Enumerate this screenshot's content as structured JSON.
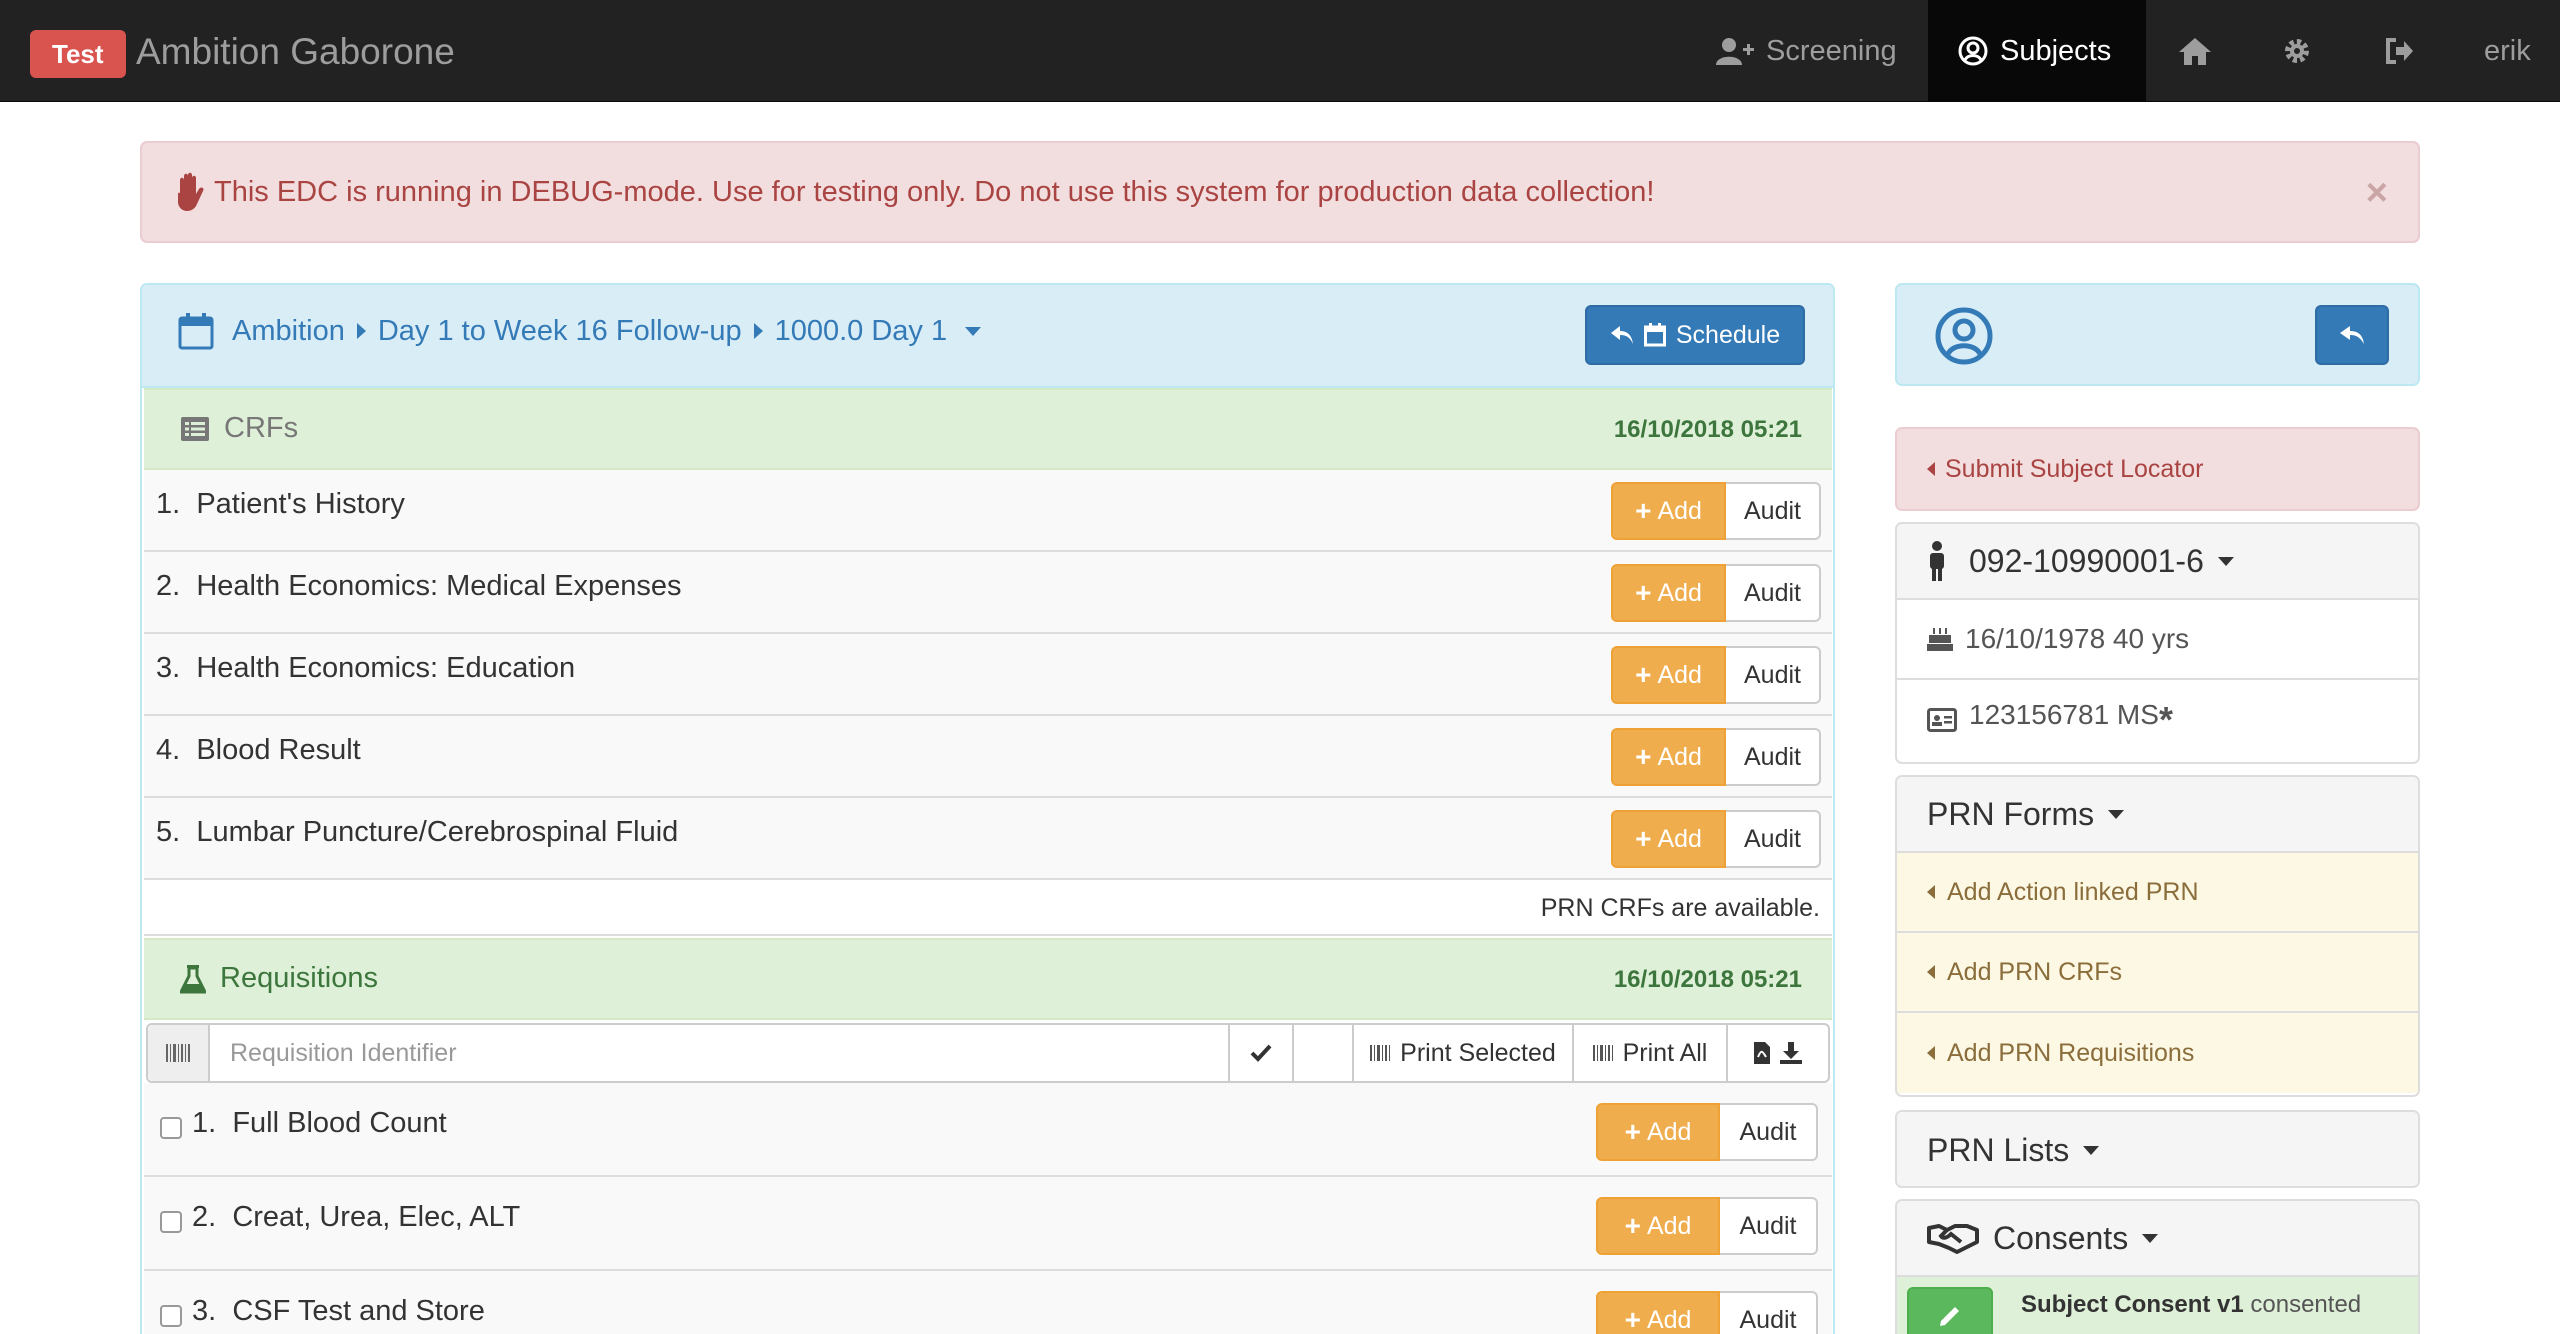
{
  "navbar": {
    "badge": "Test",
    "app_name": "Ambition Gaborone",
    "screening": "Screening",
    "subjects": "Subjects",
    "user": "erik"
  },
  "alert": {
    "message": "This EDC is running in DEBUG-mode. Use for testing only. Do not use this system for production data collection!",
    "close": "×"
  },
  "visit": {
    "breadcrumbs": [
      "Ambition",
      "Day 1 to Week 16 Follow-up",
      "1000.0 Day 1"
    ],
    "schedule_label": "Schedule"
  },
  "crfs": {
    "title": "CRFs",
    "date": "16/10/2018 05:21",
    "rows": [
      {
        "num": "1.",
        "label": "Patient's History"
      },
      {
        "num": "2.",
        "label": "Health Economics: Medical Expenses"
      },
      {
        "num": "3.",
        "label": "Health Economics: Education"
      },
      {
        "num": "4.",
        "label": "Blood Result"
      },
      {
        "num": "5.",
        "label": "Lumbar Puncture/Cerebrospinal Fluid"
      }
    ],
    "add_label": "Add",
    "audit_label": "Audit",
    "prn_note": "PRN CRFs are available."
  },
  "requisitions": {
    "title": "Requisitions",
    "date": "16/10/2018 05:21",
    "placeholder": "Requisition Identifier",
    "print_selected": "Print Selected",
    "print_all": "Print All",
    "rows": [
      {
        "num": "1.",
        "label": "Full Blood Count"
      },
      {
        "num": "2.",
        "label": "Creat, Urea, Elec, ALT"
      },
      {
        "num": "3.",
        "label": "CSF Test and Store"
      }
    ]
  },
  "sidebar": {
    "locator": "Submit Subject Locator",
    "subject_id": "092-10990001-6",
    "dob": "16/10/1978 40 yrs",
    "identity": "123156781 MS",
    "identity_mark": "*",
    "prn_forms": {
      "title": "PRN Forms",
      "items": [
        "Add Action linked PRN",
        "Add PRN CRFs",
        "Add PRN Requisitions"
      ]
    },
    "prn_lists": "PRN Lists",
    "consents": {
      "title": "Consents",
      "item": "Subject Consent v1",
      "status": "consented"
    }
  },
  "colors": {
    "navbar_bg": "#222222",
    "danger": "#d9534f",
    "primary": "#337ab7",
    "warning": "#f0ad4e",
    "success_bg": "#dff0d8",
    "info_bg": "#d9edf7"
  }
}
